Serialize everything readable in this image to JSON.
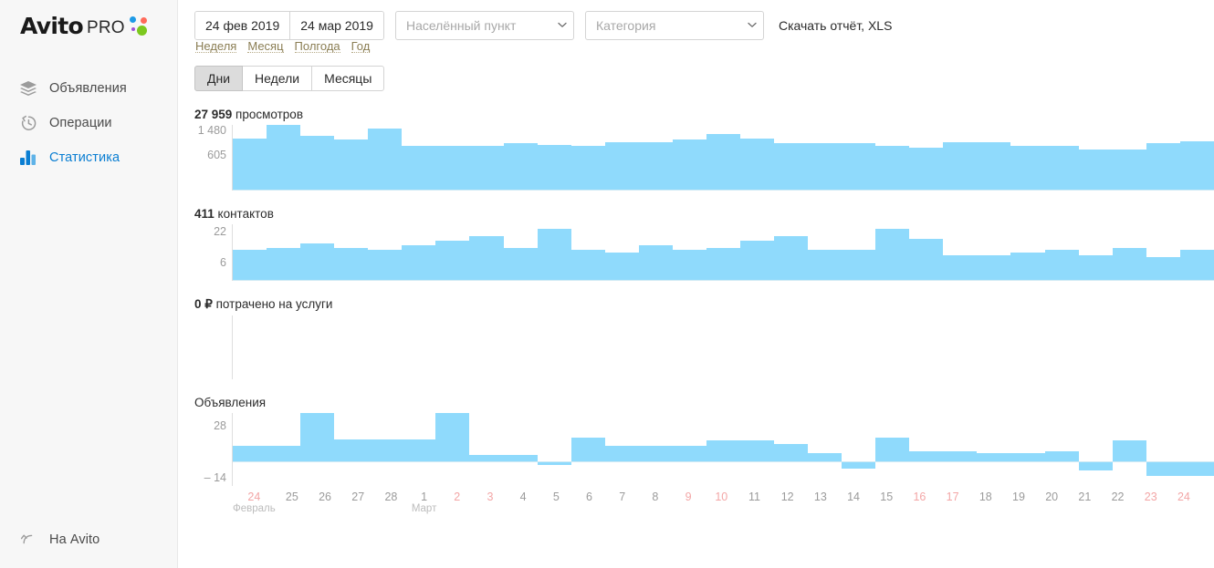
{
  "brand": {
    "name": "Avito",
    "suffix": "PRO",
    "dots": [
      "#1e9ae6",
      "#ff6a5a",
      "#9f52d6",
      "#7cc81e"
    ]
  },
  "sidebar": {
    "items": [
      {
        "label": "Объявления",
        "icon": "layers-icon",
        "active": false
      },
      {
        "label": "Операции",
        "icon": "history-icon",
        "active": false
      },
      {
        "label": "Статистика",
        "icon": "bar-chart-icon",
        "active": true
      }
    ],
    "footer": {
      "label": "На Avito",
      "icon": "arrow-up-left-icon"
    }
  },
  "toolbar": {
    "date_from": "24 фев 2019",
    "date_to": "24 мар 2019",
    "city_placeholder": "Населённый пункт",
    "city_value": "",
    "category_placeholder": "Категория",
    "category_value": "",
    "download_label": "Скачать отчёт, XLS",
    "quick_ranges": [
      "Неделя",
      "Месяц",
      "Полгода",
      "Год"
    ],
    "granularity": {
      "options": [
        "Дни",
        "Недели",
        "Месяцы"
      ],
      "selected": "Дни"
    }
  },
  "charts": {
    "views": {
      "value": "27 959",
      "unit": " просмотров",
      "yticks": [
        "1 480",
        "605"
      ]
    },
    "contacts": {
      "value": "411",
      "unit": " контактов",
      "yticks": [
        "22",
        "6"
      ]
    },
    "spend": {
      "value": "0 ₽",
      "unit": " потрачено на услуги",
      "yticks": []
    },
    "listings": {
      "value": "",
      "unit": "Объявления",
      "yticks": [
        "28",
        "– 14"
      ]
    }
  },
  "accent_colors": {
    "bar": "#8fdafc",
    "link": "#0a7ed2",
    "weekend": "#f3a6a6",
    "axis_text": "#9b9b9b"
  },
  "chart_data": [
    {
      "type": "bar",
      "title": "27 959 просмотров",
      "ylabel": "просмотров",
      "xlabel": "",
      "ylim": [
        0,
        1480
      ],
      "yticks": [
        605,
        1480
      ],
      "grid": false,
      "categories": [
        "24",
        "25",
        "26",
        "27",
        "28",
        "1",
        "2",
        "3",
        "4",
        "5",
        "6",
        "7",
        "8",
        "9",
        "10",
        "11",
        "12",
        "13",
        "14",
        "15",
        "16",
        "17",
        "18",
        "19",
        "20",
        "21",
        "22",
        "23",
        "24"
      ],
      "values": [
        1180,
        1480,
        1240,
        1150,
        1390,
        1010,
        1010,
        1010,
        1060,
        1020,
        1010,
        1090,
        1090,
        1150,
        1270,
        1170,
        1060,
        1060,
        1060,
        1000,
        960,
        1080,
        1080,
        1010,
        1000,
        930,
        930,
        1070,
        1120
      ]
    },
    {
      "type": "bar",
      "title": "411 контактов",
      "ylabel": "контактов",
      "xlabel": "",
      "ylim": [
        0,
        24
      ],
      "yticks": [
        6,
        22
      ],
      "grid": false,
      "categories": [
        "24",
        "25",
        "26",
        "27",
        "28",
        "1",
        "2",
        "3",
        "4",
        "5",
        "6",
        "7",
        "8",
        "9",
        "10",
        "11",
        "12",
        "13",
        "14",
        "15",
        "16",
        "17",
        "18",
        "19",
        "20",
        "21",
        "22",
        "23",
        "24"
      ],
      "values": [
        13,
        14,
        16,
        14,
        13,
        15,
        17,
        19,
        14,
        22,
        13,
        12,
        15,
        13,
        14,
        17,
        19,
        13,
        13,
        22,
        18,
        11,
        11,
        12,
        13,
        11,
        14,
        10,
        13
      ]
    },
    {
      "type": "bar",
      "title": "0 ₽ потрачено на услуги",
      "ylabel": "₽",
      "xlabel": "",
      "ylim": [
        0,
        0
      ],
      "yticks": [],
      "grid": false,
      "categories": [
        "24",
        "25",
        "26",
        "27",
        "28",
        "1",
        "2",
        "3",
        "4",
        "5",
        "6",
        "7",
        "8",
        "9",
        "10",
        "11",
        "12",
        "13",
        "14",
        "15",
        "16",
        "17",
        "18",
        "19",
        "20",
        "21",
        "22",
        "23",
        "24"
      ],
      "values": [
        0,
        0,
        0,
        0,
        0,
        0,
        0,
        0,
        0,
        0,
        0,
        0,
        0,
        0,
        0,
        0,
        0,
        0,
        0,
        0,
        0,
        0,
        0,
        0,
        0,
        0,
        0,
        0,
        0
      ]
    },
    {
      "type": "bar",
      "title": "Объявления",
      "ylabel": "",
      "xlabel": "",
      "ylim": [
        -14,
        28
      ],
      "yticks": [
        -14,
        28
      ],
      "grid": false,
      "note": "diverging bars around zero baseline",
      "categories": [
        "24",
        "25",
        "26",
        "27",
        "28",
        "1",
        "2",
        "3",
        "4",
        "5",
        "6",
        "7",
        "8",
        "9",
        "10",
        "11",
        "12",
        "13",
        "14",
        "15",
        "16",
        "17",
        "18",
        "19",
        "20",
        "21",
        "22",
        "23",
        "24"
      ],
      "values": [
        9,
        9,
        28,
        13,
        13,
        13,
        28,
        4,
        4,
        -2,
        14,
        9,
        9,
        9,
        12,
        12,
        10,
        5,
        -4,
        14,
        6,
        6,
        5,
        5,
        6,
        -5,
        12,
        -8,
        -8
      ]
    }
  ],
  "xaxis": {
    "ticks": [
      {
        "day": "24",
        "weekend": true,
        "month": "Февраль"
      },
      {
        "day": "25",
        "weekend": false,
        "month": ""
      },
      {
        "day": "26",
        "weekend": false,
        "month": ""
      },
      {
        "day": "27",
        "weekend": false,
        "month": ""
      },
      {
        "day": "28",
        "weekend": false,
        "month": ""
      },
      {
        "day": "1",
        "weekend": false,
        "month": "Март"
      },
      {
        "day": "2",
        "weekend": true,
        "month": ""
      },
      {
        "day": "3",
        "weekend": true,
        "month": ""
      },
      {
        "day": "4",
        "weekend": false,
        "month": ""
      },
      {
        "day": "5",
        "weekend": false,
        "month": ""
      },
      {
        "day": "6",
        "weekend": false,
        "month": ""
      },
      {
        "day": "7",
        "weekend": false,
        "month": ""
      },
      {
        "day": "8",
        "weekend": false,
        "month": ""
      },
      {
        "day": "9",
        "weekend": true,
        "month": ""
      },
      {
        "day": "10",
        "weekend": true,
        "month": ""
      },
      {
        "day": "11",
        "weekend": false,
        "month": ""
      },
      {
        "day": "12",
        "weekend": false,
        "month": ""
      },
      {
        "day": "13",
        "weekend": false,
        "month": ""
      },
      {
        "day": "14",
        "weekend": false,
        "month": ""
      },
      {
        "day": "15",
        "weekend": false,
        "month": ""
      },
      {
        "day": "16",
        "weekend": true,
        "month": ""
      },
      {
        "day": "17",
        "weekend": true,
        "month": ""
      },
      {
        "day": "18",
        "weekend": false,
        "month": ""
      },
      {
        "day": "19",
        "weekend": false,
        "month": ""
      },
      {
        "day": "20",
        "weekend": false,
        "month": ""
      },
      {
        "day": "21",
        "weekend": false,
        "month": ""
      },
      {
        "day": "22",
        "weekend": false,
        "month": ""
      },
      {
        "day": "23",
        "weekend": true,
        "month": ""
      },
      {
        "day": "24",
        "weekend": true,
        "month": ""
      }
    ]
  }
}
